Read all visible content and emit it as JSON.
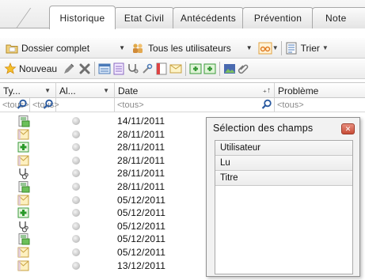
{
  "tabs": [
    {
      "label": "Historique",
      "active": true
    },
    {
      "label": "Etat Civil",
      "active": false
    },
    {
      "label": "Antécédents",
      "active": false
    },
    {
      "label": "Prévention",
      "active": false
    },
    {
      "label": "Note",
      "active": false
    }
  ],
  "toolbar1": {
    "dossier_combo": "Dossier complet",
    "users_combo": "Tous les utilisateurs",
    "sort_label": "Trier"
  },
  "toolbar2": {
    "new_label": "Nouveau"
  },
  "grid": {
    "headers": {
      "type": "Ty...",
      "lu": "Al...",
      "date": "Date",
      "probleme": "Problème"
    },
    "filters": {
      "type": "<tous>",
      "lu": "<tous>",
      "date": "<tous>",
      "probleme": "<tous>"
    },
    "rows": [
      {
        "icon": "green-doc-icon",
        "date": "14/11/2011"
      },
      {
        "icon": "envelope-icon",
        "date": "28/11/2011"
      },
      {
        "icon": "green-cross-icon",
        "date": "28/11/2011"
      },
      {
        "icon": "envelope-icon",
        "date": "28/11/2011"
      },
      {
        "icon": "stethoscope-icon",
        "date": "28/11/2011"
      },
      {
        "icon": "green-doc-icon",
        "date": "28/11/2011"
      },
      {
        "icon": "envelope-icon",
        "date": "05/12/2011"
      },
      {
        "icon": "green-cross-icon",
        "date": "05/12/2011"
      },
      {
        "icon": "stethoscope-icon",
        "date": "05/12/2011"
      },
      {
        "icon": "green-doc-icon",
        "date": "05/12/2011"
      },
      {
        "icon": "envelope-icon",
        "date": "05/12/2011"
      },
      {
        "icon": "envelope-icon",
        "date": "13/12/2011"
      }
    ]
  },
  "popup": {
    "title": "Sélection des champs",
    "items": [
      "Utilisateur",
      "Lu",
      "Titre"
    ]
  },
  "colors": {
    "accent_orange": "#f0a030",
    "close_red": "#c74c37",
    "green": "#3a9a3a"
  }
}
